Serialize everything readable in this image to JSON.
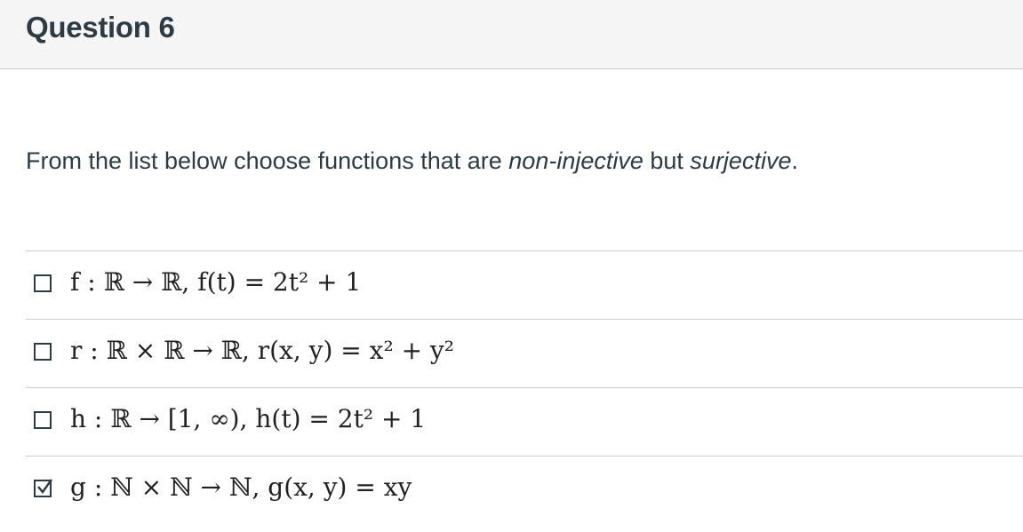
{
  "header": {
    "title": "Question 6"
  },
  "question": {
    "prompt_start": "From the list below choose functions that are ",
    "prompt_em1": "non-injective",
    "prompt_mid": " but ",
    "prompt_em2": "surjective",
    "prompt_end": "."
  },
  "answers": [
    {
      "label": "f : ℝ → ℝ, f(t) = 2t² + 1",
      "checked": false
    },
    {
      "label": "r : ℝ × ℝ → ℝ, r(x, y) = x² + y²",
      "checked": false
    },
    {
      "label": "h : ℝ → [1, ∞), h(t) = 2t² + 1",
      "checked": false
    },
    {
      "label": "g : ℕ × ℕ → ℕ, g(x, y) = xy",
      "checked": true
    }
  ]
}
